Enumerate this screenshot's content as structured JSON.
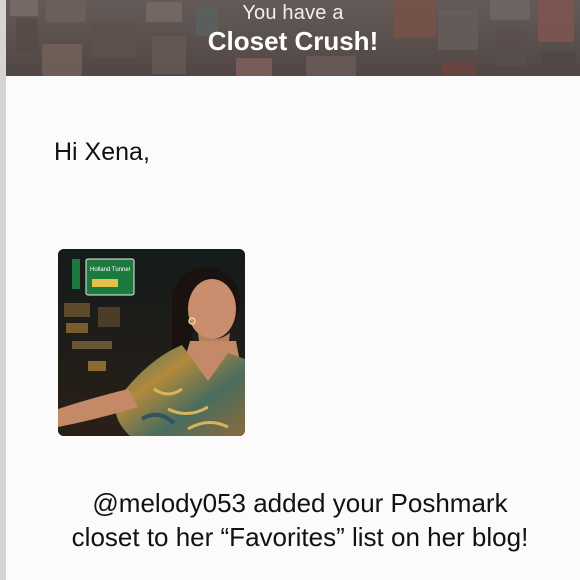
{
  "banner": {
    "subtitle": "You have a",
    "title": "Closet Crush!"
  },
  "greeting": "Hi Xena,",
  "avatar": {
    "alt": "profile photo of @melody053"
  },
  "sign_text": "Holland Tunnel",
  "message": "@melody053 added your Poshmark closet to her “Favorites” list on her blog!"
}
